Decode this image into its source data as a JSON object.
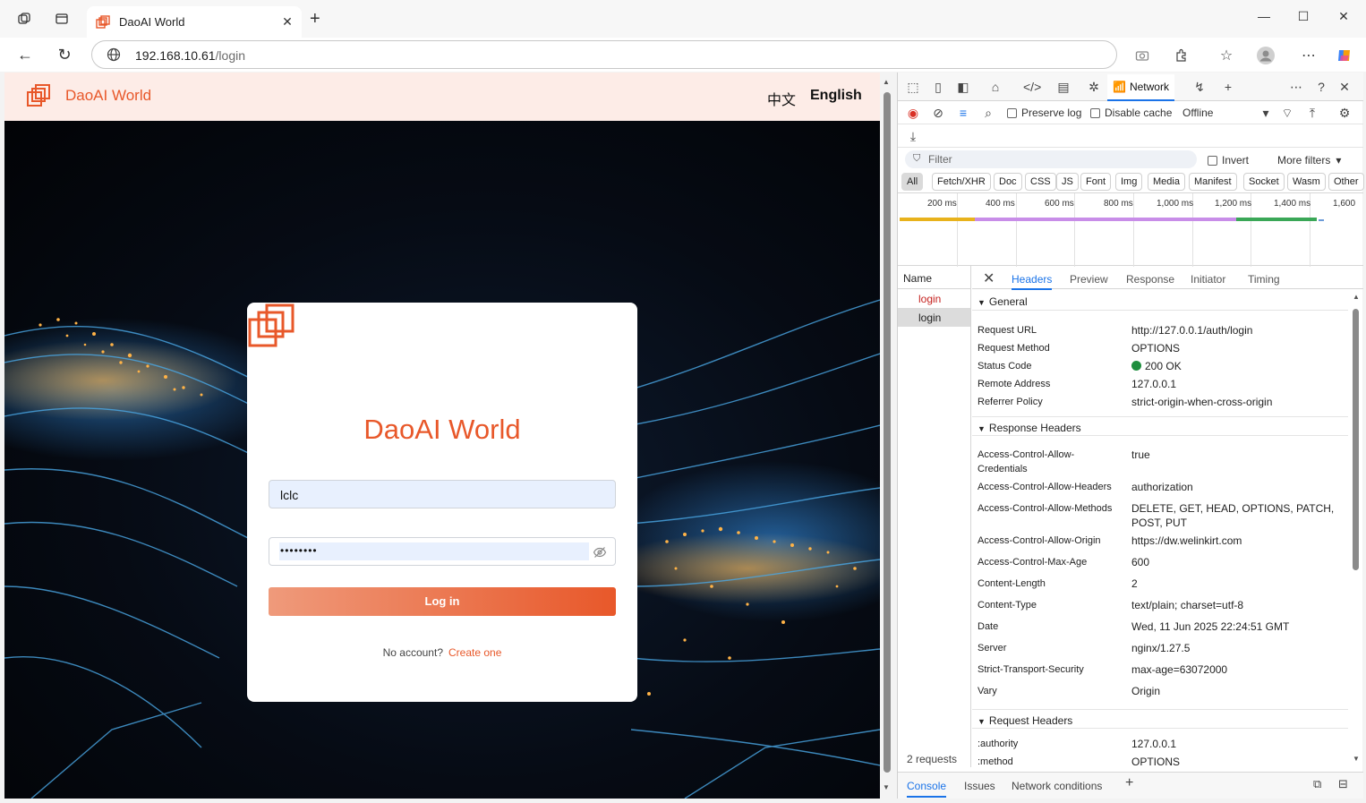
{
  "browser": {
    "tab_title": "DaoAI World",
    "url_host": "192.168.10.61",
    "url_path": "/login"
  },
  "page": {
    "header": {
      "site_name": "DaoAI World",
      "lang_zh": "中文",
      "lang_en": "English"
    },
    "login": {
      "title": "DaoAI World",
      "username_value": "lclc",
      "password_mask": "••••••••",
      "login_label": "Log in",
      "no_account_text": "No account?",
      "create_link": "Create one"
    }
  },
  "devtools": {
    "active_panel": "Network",
    "controls": {
      "preserve_log": "Preserve log",
      "disable_cache": "Disable cache",
      "throttle": "Offline"
    },
    "filter": {
      "placeholder": "Filter",
      "invert": "Invert",
      "more_filters": "More filters"
    },
    "type_filters": [
      "All",
      "Fetch/XHR",
      "Doc",
      "CSS",
      "JS",
      "Font",
      "Img",
      "Media",
      "Manifest",
      "Socket",
      "Wasm",
      "Other"
    ],
    "timeline_ticks": [
      "200 ms",
      "400 ms",
      "600 ms",
      "800 ms",
      "1,000 ms",
      "1,200 ms",
      "1,400 ms",
      "1,600"
    ],
    "timeline_colors": {
      "stalled": "#e8b21c",
      "waiting": "#c88de8",
      "download": "#3aa757",
      "other": "#6b9bd8"
    },
    "requests": {
      "header": "Name",
      "items": [
        "login",
        "login"
      ],
      "count": "2 requests"
    },
    "detail_tabs": [
      "Headers",
      "Preview",
      "Response",
      "Initiator",
      "Timing"
    ],
    "general": {
      "title": "General",
      "rows": [
        {
          "k": "Request URL",
          "v": "http://127.0.0.1/auth/login"
        },
        {
          "k": "Request Method",
          "v": "OPTIONS"
        },
        {
          "k": "Status Code",
          "v": "200 OK"
        },
        {
          "k": "Remote Address",
          "v": "127.0.0.1"
        },
        {
          "k": "Referrer Policy",
          "v": "strict-origin-when-cross-origin"
        }
      ]
    },
    "response_headers": {
      "title": "Response Headers",
      "rows": [
        {
          "k1": "Access-Control-Allow-",
          "k2": "Credentials",
          "v": "true"
        },
        {
          "k": "Access-Control-Allow-Headers",
          "v": "authorization"
        },
        {
          "k": "Access-Control-Allow-Methods",
          "v1": "DELETE, GET, HEAD, OPTIONS, PATCH,",
          "v2": "POST, PUT"
        },
        {
          "k": "Access-Control-Allow-Origin",
          "v": "https://dw.welinkirt.com"
        },
        {
          "k": "Access-Control-Max-Age",
          "v": "600"
        },
        {
          "k": "Content-Length",
          "v": "2"
        },
        {
          "k": "Content-Type",
          "v": "text/plain; charset=utf-8"
        },
        {
          "k": "Date",
          "v": "Wed, 11 Jun 2025 22:24:51 GMT"
        },
        {
          "k": "Server",
          "v": "nginx/1.27.5"
        },
        {
          "k": "Strict-Transport-Security",
          "v": "max-age=63072000"
        },
        {
          "k": "Vary",
          "v": "Origin"
        }
      ]
    },
    "request_headers": {
      "title": "Request Headers",
      "rows": [
        {
          "k": ":authority",
          "v": "127.0.0.1"
        },
        {
          "k": ":method",
          "v": "OPTIONS"
        }
      ]
    },
    "drawer_tabs": [
      "Console",
      "Issues",
      "Network conditions"
    ]
  },
  "colors": {
    "accent": "#e8582a",
    "devtools_blue": "#1a73e8",
    "status_ok": "#1e8e3e"
  }
}
